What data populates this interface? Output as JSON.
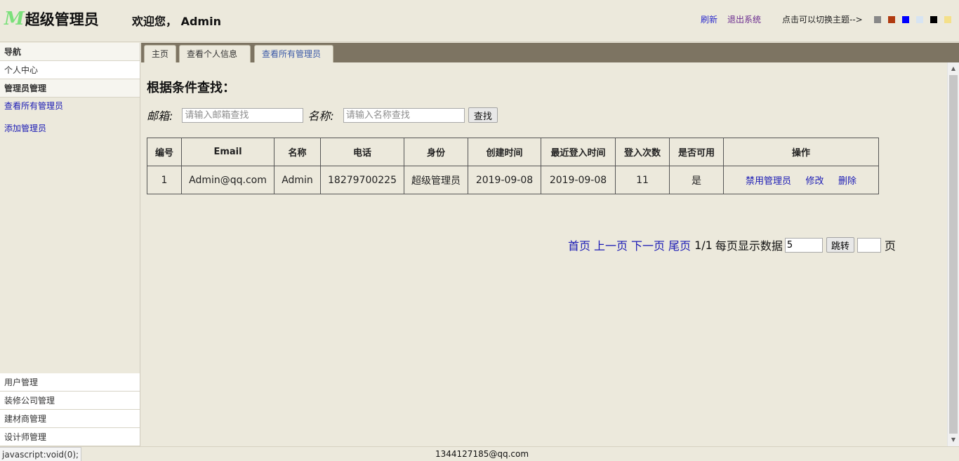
{
  "header": {
    "logo_mark": "M",
    "logo_text": "超级管理员",
    "welcome": "欢迎您， Admin",
    "refresh": "刷新",
    "logout": "退出系统",
    "theme_label": "点击可以切换主题-->",
    "theme_colors": [
      "#888888",
      "#b03a10",
      "#0000ff",
      "#d7e4f2",
      "#000000",
      "#f4e08a"
    ]
  },
  "sidebar": {
    "nav_title": "导航",
    "personal": "个人中心",
    "admin_section": "管理员管理",
    "admin_links": [
      "查看所有管理员",
      "添加管理员"
    ],
    "bottom_items": [
      "用户管理",
      "装修公司管理",
      "建材商管理",
      "设计师管理"
    ]
  },
  "tabs": [
    "主页",
    "查看个人信息",
    "查看所有管理员"
  ],
  "search": {
    "title": "根据条件查找：",
    "email_label": "邮箱:",
    "email_placeholder": "请输入邮箱查找",
    "name_label": "名称:",
    "name_placeholder": "请输入名称查找",
    "button": "查找"
  },
  "table": {
    "headers": [
      "编号",
      "Email",
      "名称",
      "电话",
      "身份",
      "创建时间",
      "最近登入时间",
      "登入次数",
      "是否可用",
      "操作"
    ],
    "row": {
      "id": "1",
      "email": "Admin@qq.com",
      "name": "Admin",
      "phone": "18279700225",
      "role": "超级管理员",
      "created": "2019-09-08",
      "last_login": "2019-09-08",
      "login_count": "11",
      "enabled": "是",
      "actions": [
        "禁用管理员",
        "修改",
        "删除"
      ]
    }
  },
  "pager": {
    "first": "首页",
    "prev": "上一页",
    "next": "下一页",
    "last": "尾页",
    "info": "1/1",
    "per_page_label": "每页显示数据",
    "per_page_value": "5",
    "jump": "跳转",
    "page_unit": "页"
  },
  "footer": {
    "status_url": "javascript:void(0);",
    "email": "1344127185@qq.com"
  }
}
